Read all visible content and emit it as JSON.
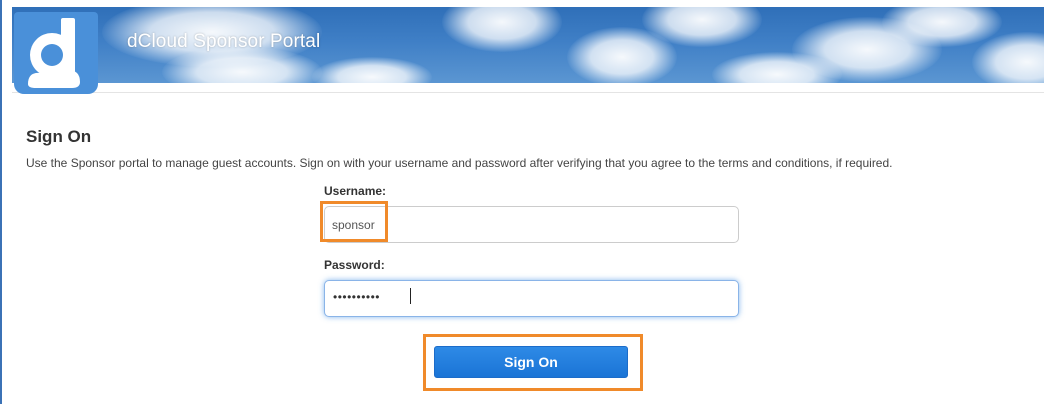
{
  "header": {
    "title": "dCloud Sponsor Portal",
    "logo_icon": "dcloud-logo-icon"
  },
  "signon": {
    "heading": "Sign On",
    "description": "Use the Sponsor portal to manage guest accounts. Sign on with your username and password after verifying that you agree to the terms and conditions, if required.",
    "username_label": "Username:",
    "username_value": "sponsor",
    "password_label": "Password:",
    "password_masked": "••••••••••",
    "button_label": "Sign On"
  },
  "colors": {
    "header_blue": "#3f7fc6",
    "button_blue": "#1a74d6",
    "highlight_orange": "#f08a2a",
    "focus_glow": "#5298e6"
  }
}
